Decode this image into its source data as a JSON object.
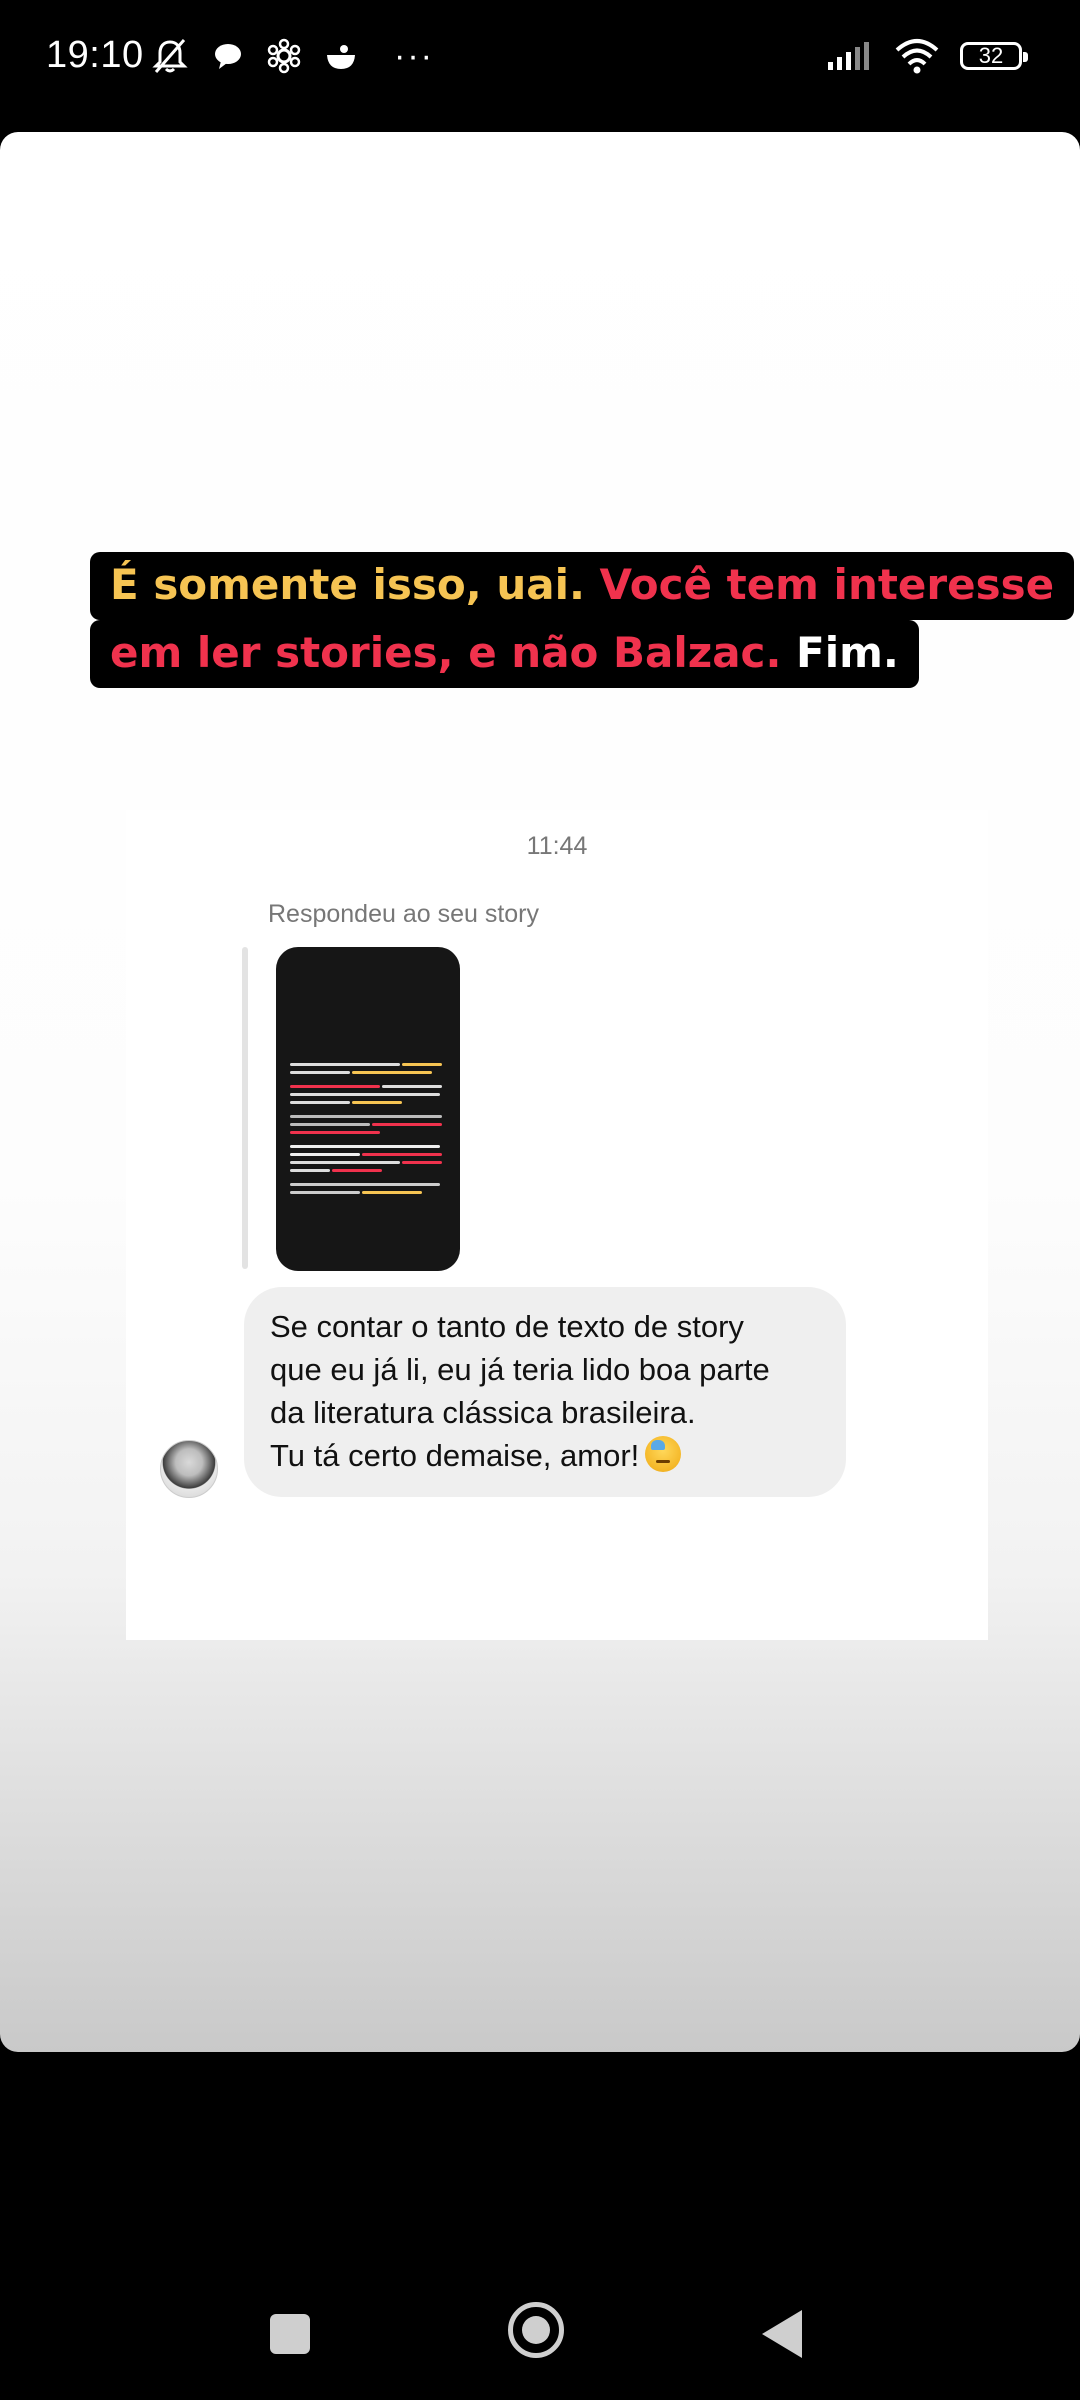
{
  "status_bar": {
    "time": "19:10",
    "more_dots": "···",
    "battery_level": "32",
    "icons_left": [
      "mute-notifications-icon",
      "chat-bubble-icon",
      "settings-flower-icon",
      "bowl-icon"
    ],
    "icons_right": [
      "signal-icon",
      "wifi-icon",
      "battery-icon"
    ]
  },
  "story": {
    "caption_line1_yellow": "É somente isso, uai. ",
    "caption_line1_red": "Você tem interesse",
    "caption_line2_red": "em ler stories, e não Balzac. ",
    "caption_line2_white": "Fim.",
    "colors": {
      "yellow": "#f6c453",
      "red": "#f0324d",
      "white": "#ffffff"
    }
  },
  "dm": {
    "time": "11:44",
    "replied_label": "Respondeu ao seu story",
    "message_lines": [
      "Se contar o tanto de texto de story",
      "que eu já li, eu já teria lido boa parte",
      "da literatura clássica brasileira.",
      "Tu tá certo demaise, amor!"
    ],
    "emoji": "sad-sweat-emoji"
  },
  "nav": {
    "icons": [
      "recents-square-icon",
      "home-circle-icon",
      "back-triangle-icon"
    ]
  }
}
